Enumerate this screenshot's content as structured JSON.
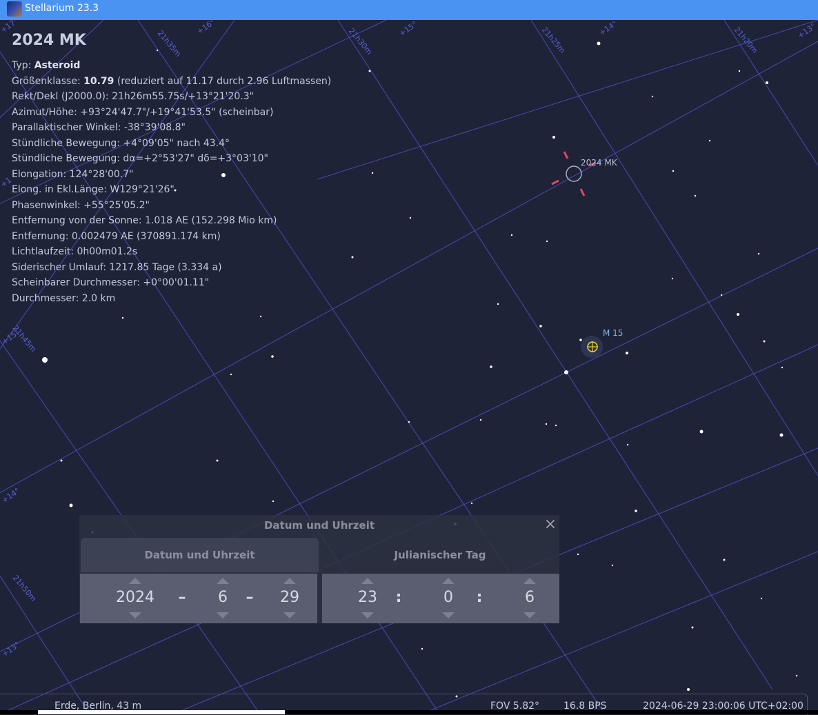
{
  "window": {
    "title": "Stellarium 23.3"
  },
  "info": {
    "name": "2024 MK",
    "lines": [
      {
        "label": "Typ: ",
        "bold": "Asteroid",
        "rest": ""
      },
      {
        "label": "Größenklasse: ",
        "bold": "10.79",
        "rest": " (reduziert auf 11.17 durch 2.96 Luftmassen)"
      },
      {
        "label": "Rekt/Dekl (J2000.0): 21h26m55.75s/+13°21'20.3\"",
        "bold": "",
        "rest": ""
      },
      {
        "label": "Azimut/Höhe: +93°24'47.7\"/+19°41'53.5\" (scheinbar)",
        "bold": "",
        "rest": ""
      },
      {
        "label": "Parallaktischer Winkel: -38°39'08.8\"",
        "bold": "",
        "rest": ""
      },
      {
        "label": "Stündliche Bewegung: +4°09'05\" nach 43.4°",
        "bold": "",
        "rest": ""
      },
      {
        "label": "Stündliche Bewegung: dα=+2°53'27\" dδ=+3°03'10\"",
        "bold": "",
        "rest": ""
      },
      {
        "label": "Elongation: 124°28'00.7\"",
        "bold": "",
        "rest": ""
      },
      {
        "label": "Elong. in Ekl.Länge: W129°21'26\"",
        "bold": "",
        "rest": ""
      },
      {
        "label": "Phasenwinkel: +55°25'05.2\"",
        "bold": "",
        "rest": ""
      },
      {
        "label": "Entfernung von der Sonne: 1.018 AE (152.298 Mio km)",
        "bold": "",
        "rest": ""
      },
      {
        "label": "Entfernung: 0.002479 AE (370891.174 km)",
        "bold": "",
        "rest": ""
      },
      {
        "label": "Lichtlaufzeit: 0h00m01.2s",
        "bold": "",
        "rest": ""
      },
      {
        "label": "Siderischer Umlauf: 1217.85 Tage (3.334 a)",
        "bold": "",
        "rest": ""
      },
      {
        "label": "Scheinbarer Durchmesser: +0°00'01.11\"",
        "bold": "",
        "rest": ""
      },
      {
        "label": "Durchmesser: 2.0 km",
        "bold": "",
        "rest": ""
      }
    ]
  },
  "sky": {
    "selected_label": "2024 MK",
    "cluster_label": "M 15",
    "grid_labels": [
      "21h35m",
      "+16°",
      "21h30m",
      "+15°",
      "21h25m",
      "+14°",
      "21h20m",
      "+13°",
      "21h45m",
      "+15°",
      "+14°",
      "21h50m",
      "+13°",
      "+17°",
      "+1"
    ],
    "colors": {
      "marker": "#e0485e",
      "cluster": "#7fb8e6",
      "grid": "#4b53c8"
    }
  },
  "dialog": {
    "title": "Datum und Uhrzeit",
    "close_icon": "close-icon",
    "tab_date": "Datum und Uhrzeit",
    "tab_jd": "Julianischer Tag",
    "year": "2024",
    "month": "6",
    "day": "29",
    "hour": "23",
    "minute": "0",
    "second": "6",
    "date_sep": "–",
    "time_sep": ":"
  },
  "status": {
    "location": "Erde, Berlin, 43 m",
    "fov": "FOV 5.82°",
    "fps": "16.8 BPS",
    "datetime": "2024-06-29 23:00:06 UTC+02:00"
  }
}
